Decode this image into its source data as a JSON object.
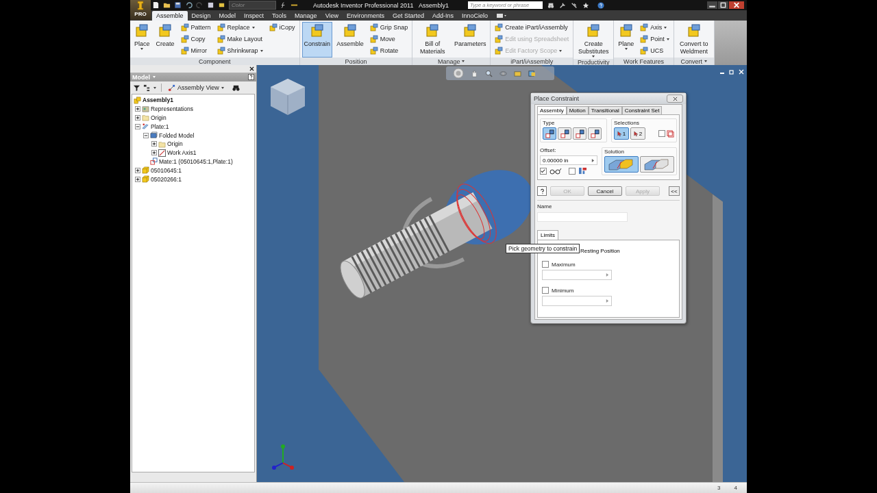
{
  "title_bar": {
    "app_badge": "PRO",
    "style_field": {
      "placeholder": "Color"
    },
    "title": "Autodesk Inventor Professional 2011",
    "document": "Assembly1",
    "search": {
      "placeholder": "Type a keyword or phrase"
    }
  },
  "tabs": [
    {
      "label": "Assemble",
      "selected": true
    },
    {
      "label": "Design",
      "selected": false
    },
    {
      "label": "Model",
      "selected": false
    },
    {
      "label": "Inspect",
      "selected": false
    },
    {
      "label": "Tools",
      "selected": false
    },
    {
      "label": "Manage",
      "selected": false
    },
    {
      "label": "View",
      "selected": false
    },
    {
      "label": "Environments",
      "selected": false
    },
    {
      "label": "Get Started",
      "selected": false
    },
    {
      "label": "Add-Ins",
      "selected": false
    },
    {
      "label": "InnoCielo",
      "selected": false
    }
  ],
  "ribbon_panels": [
    {
      "title": "Component",
      "has_menu": false,
      "tools": [
        {
          "kind": "large",
          "label": "Place",
          "dropdown": true,
          "selected": false,
          "disabled": false
        },
        {
          "kind": "large",
          "label": "Create",
          "dropdown": false,
          "selected": false,
          "disabled": false
        },
        {
          "kind": "small",
          "label": "Pattern",
          "dropdown": false,
          "selected": false,
          "disabled": false
        },
        {
          "kind": "small",
          "label": "Copy",
          "dropdown": false,
          "selected": false,
          "disabled": false
        },
        {
          "kind": "small",
          "label": "Mirror",
          "dropdown": false,
          "selected": false,
          "disabled": false
        },
        {
          "kind": "small",
          "label": "Replace",
          "dropdown": true,
          "selected": false,
          "disabled": false
        },
        {
          "kind": "small",
          "label": "Make Layout",
          "dropdown": false,
          "selected": false,
          "disabled": false
        },
        {
          "kind": "small",
          "label": "Shrinkwrap",
          "dropdown": true,
          "selected": false,
          "disabled": false
        },
        {
          "kind": "small",
          "label": "iCopy",
          "dropdown": false,
          "selected": false,
          "disabled": false
        }
      ]
    },
    {
      "title": "Position",
      "has_menu": false,
      "tools": [
        {
          "kind": "large",
          "label": "Constrain",
          "dropdown": false,
          "selected": true,
          "disabled": false
        },
        {
          "kind": "large",
          "label": "Assemble",
          "dropdown": false,
          "selected": false,
          "disabled": false
        },
        {
          "kind": "small",
          "label": "Grip Snap",
          "dropdown": false,
          "selected": false,
          "disabled": false
        },
        {
          "kind": "small",
          "label": "Move",
          "dropdown": false,
          "selected": false,
          "disabled": false
        },
        {
          "kind": "small",
          "label": "Rotate",
          "dropdown": false,
          "selected": false,
          "disabled": false
        }
      ]
    },
    {
      "title": "Manage",
      "has_menu": true,
      "tools": [
        {
          "kind": "large",
          "label": "Bill of Materials",
          "dropdown": false,
          "selected": false,
          "disabled": false
        },
        {
          "kind": "large",
          "label": "Parameters",
          "dropdown": false,
          "selected": false,
          "disabled": false
        }
      ]
    },
    {
      "title": "iPart/iAssembly",
      "has_menu": false,
      "tools": [
        {
          "kind": "small",
          "label": "Create iPart/iAssembly",
          "dropdown": false,
          "selected": false,
          "disabled": false
        },
        {
          "kind": "small",
          "label": "Edit using Spreadsheet",
          "dropdown": false,
          "selected": false,
          "disabled": true
        },
        {
          "kind": "small",
          "label": "Edit Factory Scope",
          "dropdown": true,
          "selected": false,
          "disabled": true
        }
      ]
    },
    {
      "title": "Productivity",
      "has_menu": false,
      "tools": [
        {
          "kind": "large",
          "label": "Create Substitutes",
          "dropdown": true,
          "selected": false,
          "disabled": false
        }
      ]
    },
    {
      "title": "Work Features",
      "has_menu": false,
      "tools": [
        {
          "kind": "large",
          "label": "Plane",
          "dropdown": true,
          "selected": false,
          "disabled": false
        },
        {
          "kind": "small",
          "label": "Axis",
          "dropdown": true,
          "selected": false,
          "disabled": false
        },
        {
          "kind": "small",
          "label": "Point",
          "dropdown": true,
          "selected": false,
          "disabled": false
        },
        {
          "kind": "small",
          "label": "UCS",
          "dropdown": false,
          "selected": false,
          "disabled": false
        }
      ]
    },
    {
      "title": "Convert",
      "has_menu": true,
      "tools": [
        {
          "kind": "large",
          "label": "Convert to Weldment",
          "dropdown": false,
          "selected": false,
          "disabled": false
        }
      ]
    }
  ],
  "browser": {
    "title": "Model",
    "view": "Assembly View",
    "tree": [
      {
        "label": "Assembly1",
        "kind": "assembly",
        "children": [
          {
            "label": "Representations",
            "kind": "representations",
            "expanded": false
          },
          {
            "label": "Origin",
            "kind": "folder",
            "expanded": false
          },
          {
            "label": "Plate:1",
            "kind": "part",
            "expanded": true,
            "children": [
              {
                "label": "Folded Model",
                "kind": "model",
                "expanded": true,
                "children": [
                  {
                    "label": "Origin",
                    "kind": "folder",
                    "expanded": false
                  },
                  {
                    "label": "Work Axis1",
                    "kind": "axis",
                    "expanded": false
                  }
                ]
              },
              {
                "label": "Mate:1 (05010645:1,Plate:1)",
                "kind": "constraint"
              }
            ]
          },
          {
            "label": "05010645:1",
            "kind": "component",
            "expanded": false
          },
          {
            "label": "05020266:1",
            "kind": "component",
            "expanded": false
          }
        ]
      }
    ]
  },
  "dialog": {
    "title": "Place Constraint",
    "tabs": [
      {
        "label": "Assembly",
        "selected": true
      },
      {
        "label": "Motion",
        "selected": false
      },
      {
        "label": "Transitional",
        "selected": false
      },
      {
        "label": "Constraint Set",
        "selected": false
      }
    ],
    "type_label": "Type",
    "types": [
      {
        "selected": true
      },
      {
        "selected": false
      },
      {
        "selected": false
      },
      {
        "selected": false
      }
    ],
    "selections_label": "Selections",
    "selections": [
      {
        "label": "1",
        "selected": true
      },
      {
        "label": "2",
        "selected": false
      }
    ],
    "pick_part_first": {
      "checked": false
    },
    "offset_label": "Offset:",
    "offset_value": "0.00000 in",
    "show_preview": {
      "checked": true
    },
    "predict_offset": {
      "checked": false
    },
    "solution_label": "Solution",
    "solutions": [
      {
        "selected": true
      },
      {
        "selected": false
      }
    ],
    "buttons": [
      {
        "label": "OK",
        "disabled": true
      },
      {
        "label": "Cancel",
        "disabled": false
      },
      {
        "label": "Apply",
        "disabled": true
      }
    ],
    "more_button": "<<",
    "name_label": "Name",
    "limits_tab": "Limits",
    "resting_position": "Resting Position",
    "limits": [
      {
        "label": "Maximum",
        "checked": false
      },
      {
        "label": "Minimum",
        "checked": false
      }
    ]
  },
  "tooltip": "Pick geometry to constrain",
  "status_bar": [
    "3",
    "4"
  ]
}
